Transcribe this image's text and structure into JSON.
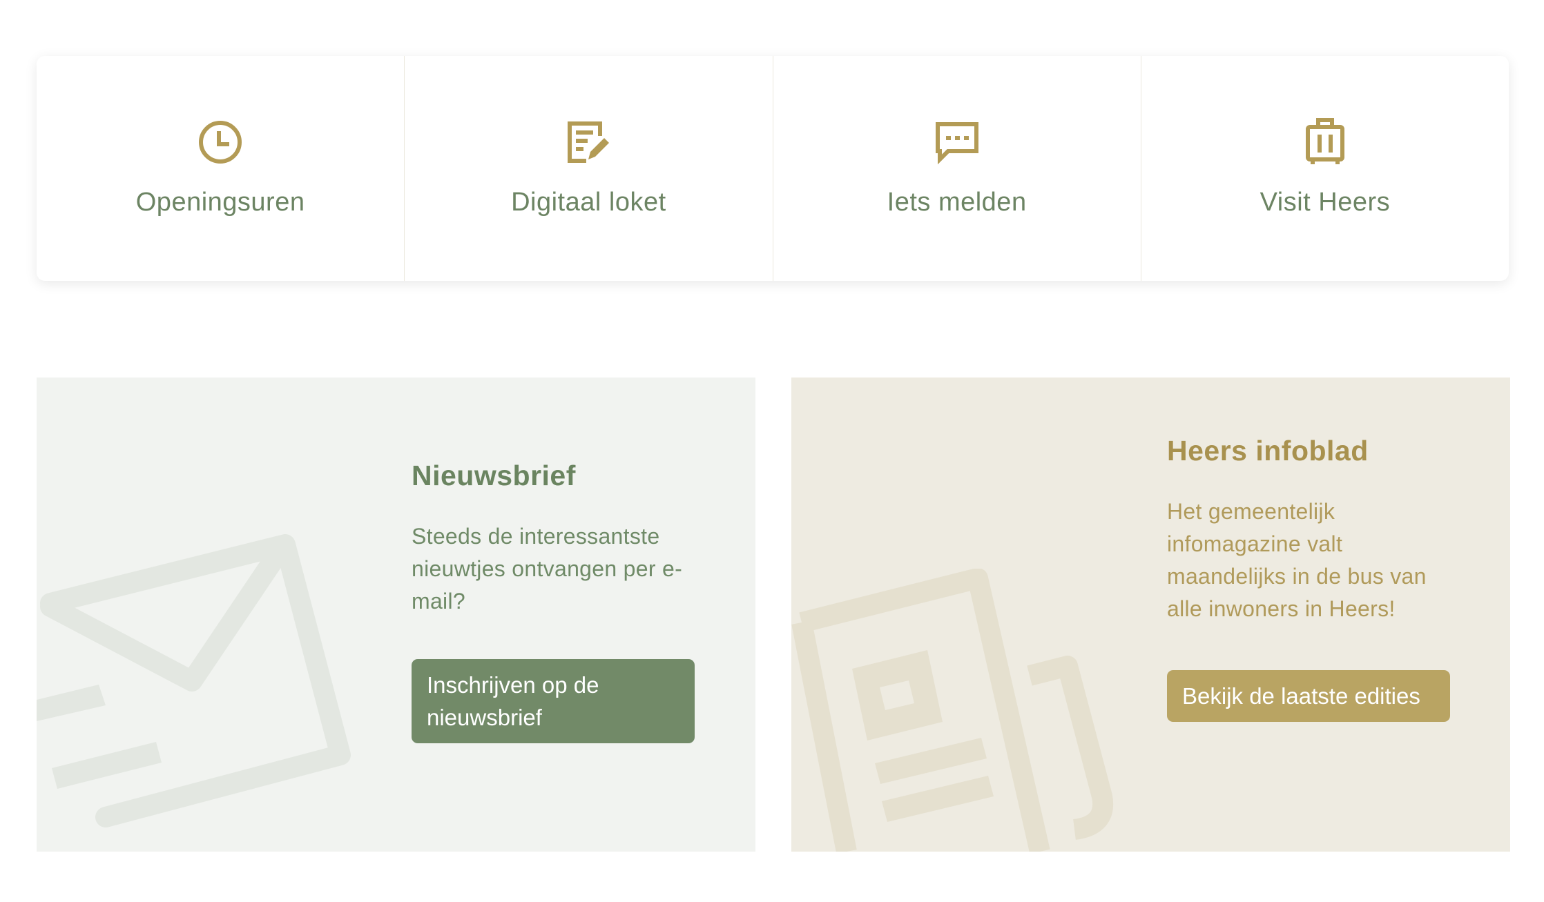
{
  "quicklinks": [
    {
      "label": "Openingsuren",
      "icon": "clock-icon"
    },
    {
      "label": "Digitaal loket",
      "icon": "edit-document-icon"
    },
    {
      "label": "Iets melden",
      "icon": "chat-bubble-icon"
    },
    {
      "label": "Visit Heers",
      "icon": "suitcase-icon"
    }
  ],
  "newsletter": {
    "title": "Nieuwsbrief",
    "text": "Steeds de interessantste nieuwtjes ontvangen per e-mail?",
    "button": "Inschrijven op de nieuwsbrief",
    "illustration": "envelope-icon"
  },
  "infoblad": {
    "title": "Heers infoblad",
    "text": "Het gemeentelijk infomagazine valt maandelijks in de bus van alle inwoners in Heers!",
    "button": "Bekijk de laatste edities",
    "illustration": "newspaper-icon"
  },
  "colors": {
    "green": "#728a68",
    "gold": "#b9a463",
    "icon_gold": "#b39b55",
    "newsletter_bg": "#f1f3f0",
    "infoblad_bg": "#eeebe1"
  }
}
